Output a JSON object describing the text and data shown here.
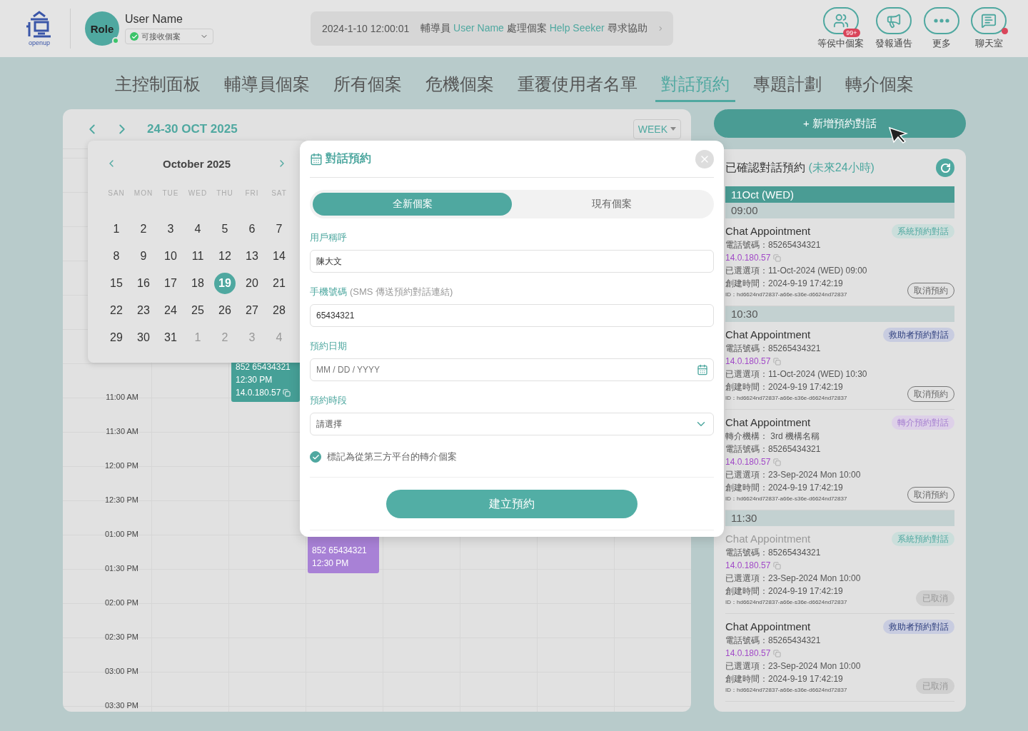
{
  "header": {
    "logo": "openup",
    "avatar": "Role",
    "online": true,
    "user_name": "User Name",
    "status": "可接收個案",
    "notice": {
      "time": "2024-1-10 12:00:01",
      "parts": [
        {
          "text": "輔導員 ",
          "highlight": false
        },
        {
          "text": "User Name",
          "highlight": true
        },
        {
          "text": " 處理個案 ",
          "highlight": false
        },
        {
          "text": "Help Seeker",
          "highlight": true
        },
        {
          "text": " 尋求協助",
          "highlight": false
        }
      ]
    },
    "actions": [
      {
        "kind": "waiting",
        "label": "等侯中個案",
        "badge": "99+",
        "alert": false
      },
      {
        "kind": "announce",
        "label": "發報通告",
        "alert": false
      },
      {
        "kind": "more",
        "label": "更多",
        "alert": false
      },
      {
        "kind": "chat",
        "label": "聊天室",
        "alert": true
      }
    ]
  },
  "tabs": [
    {
      "label": "主控制面板",
      "selected": false
    },
    {
      "label": "輔導員個案",
      "selected": false
    },
    {
      "label": "所有個案",
      "selected": false
    },
    {
      "label": "危機個案",
      "selected": false
    },
    {
      "label": "重覆使用者名單",
      "selected": false
    },
    {
      "label": "對話預約",
      "selected": true
    },
    {
      "label": "專題計劃",
      "selected": false
    },
    {
      "label": "轉介個案",
      "selected": false
    }
  ],
  "calendar": {
    "range": "24-30 OCT 2025",
    "view": "WEEK",
    "times": [
      "11:00 AM",
      "11:30 AM",
      "12:00 PM",
      "12:30 PM",
      "01:00 PM",
      "01:30 PM",
      "02:00 PM",
      "02:30 PM",
      "03:00 PM",
      "03:30 PM"
    ],
    "events": [
      {
        "color": "#46a097",
        "lines": [
          "852 65434321",
          "12:30 PM"
        ],
        "ip": "14.0.180.57"
      },
      {
        "color": "#a881d6",
        "lines": [
          "852 65434321",
          "12:30 PM"
        ]
      }
    ]
  },
  "date_picker": {
    "month": "October 2025",
    "weekdays": [
      "SAN",
      "MON",
      "TUE",
      "WED",
      "THU",
      "FRI",
      "SAT"
    ],
    "days": [
      {
        "label": "1",
        "outside": false,
        "selected": false
      },
      {
        "label": "2",
        "outside": false,
        "selected": false
      },
      {
        "label": "3",
        "outside": false,
        "selected": false
      },
      {
        "label": "4",
        "outside": false,
        "selected": false
      },
      {
        "label": "5",
        "outside": false,
        "selected": false
      },
      {
        "label": "6",
        "outside": false,
        "selected": false
      },
      {
        "label": "7",
        "outside": false,
        "selected": false
      },
      {
        "label": "8",
        "outside": false,
        "selected": false
      },
      {
        "label": "9",
        "outside": false,
        "selected": false
      },
      {
        "label": "10",
        "outside": false,
        "selected": false
      },
      {
        "label": "11",
        "outside": false,
        "selected": false
      },
      {
        "label": "12",
        "outside": false,
        "selected": false
      },
      {
        "label": "13",
        "outside": false,
        "selected": false
      },
      {
        "label": "14",
        "outside": false,
        "selected": false
      },
      {
        "label": "15",
        "outside": false,
        "selected": false
      },
      {
        "label": "16",
        "outside": false,
        "selected": false
      },
      {
        "label": "17",
        "outside": false,
        "selected": false
      },
      {
        "label": "18",
        "outside": false,
        "selected": false
      },
      {
        "label": "19",
        "outside": false,
        "selected": true
      },
      {
        "label": "20",
        "outside": false,
        "selected": false
      },
      {
        "label": "21",
        "outside": false,
        "selected": false
      },
      {
        "label": "22",
        "outside": false,
        "selected": false
      },
      {
        "label": "23",
        "outside": false,
        "selected": false
      },
      {
        "label": "24",
        "outside": false,
        "selected": false
      },
      {
        "label": "25",
        "outside": false,
        "selected": false
      },
      {
        "label": "26",
        "outside": false,
        "selected": false
      },
      {
        "label": "27",
        "outside": false,
        "selected": false
      },
      {
        "label": "28",
        "outside": false,
        "selected": false
      },
      {
        "label": "29",
        "outside": false,
        "selected": false
      },
      {
        "label": "30",
        "outside": false,
        "selected": false
      },
      {
        "label": "31",
        "outside": false,
        "selected": false
      },
      {
        "label": "1",
        "outside": true,
        "selected": false
      },
      {
        "label": "2",
        "outside": true,
        "selected": false
      },
      {
        "label": "3",
        "outside": true,
        "selected": false
      },
      {
        "label": "4",
        "outside": true,
        "selected": false
      }
    ]
  },
  "modal": {
    "title": "對話預約",
    "modes": [
      {
        "label": "全新個案",
        "selected": true
      },
      {
        "label": "現有個案",
        "selected": false
      }
    ],
    "fields": [
      {
        "kind": "text",
        "label": "用戶稱呼",
        "value": "陳大文"
      },
      {
        "kind": "text",
        "label": "手機號碼",
        "hint": "(SMS 傳送預約對話連結)",
        "value": "65434321"
      },
      {
        "kind": "date",
        "label": "預約日期",
        "placeholder": "MM / DD / YYYY"
      },
      {
        "kind": "select",
        "label": "預約時段",
        "value": "請選擇"
      }
    ],
    "referral": {
      "label": "標記為從第三方平台的轉介個案",
      "checked": true
    },
    "submit": "建立預約"
  },
  "add_button": "+ 新增預約對話",
  "appointments": {
    "title": "已確認對話預約",
    "subtitle": "(未來24小時)",
    "date": "11Oct (WED)",
    "slots": [
      {
        "time": "09:00",
        "items": [
          {
            "title": "Chat Appointment",
            "muted": false,
            "tag": {
              "kind": "system",
              "label": "系統預約對話"
            },
            "phone": "電話號碼：85265434321",
            "ip": "14.0.180.57",
            "chosen": "已選選項：11-Oct-2024 (WED) 09:00",
            "created": "創建時間：2024-9-19 17:42:19",
            "id": "ID：hd6624nd72837-a66e-s36e-d6624nd72837",
            "action": {
              "label": "取消預約",
              "cancelled": false
            }
          }
        ]
      },
      {
        "time": "10:30",
        "items": [
          {
            "title": "Chat Appointment",
            "muted": false,
            "tag": {
              "kind": "helper",
              "label": "救助者預約對話"
            },
            "phone": "電話號碼：85265434321",
            "ip": "14.0.180.57",
            "chosen": "已選選項：11-Oct-2024 (WED) 10:30",
            "created": "創建時間：2024-9-19 17:42:19",
            "id": "ID：hd6624nd72837-a66e-s36e-d6624nd72837",
            "action": {
              "label": "取消預約",
              "cancelled": false
            }
          },
          {
            "title": "Chat Appointment",
            "muted": false,
            "tag": {
              "kind": "referral",
              "label": "轉介預約對話"
            },
            "referrer": "轉介機構： 3rd 機構名稱",
            "phone": "電話號碼：85265434321",
            "ip": "14.0.180.57",
            "chosen": "已選選項：23-Sep-2024 Mon 10:00",
            "created": "創建時間：2024-9-19 17:42:19",
            "id": "ID：hd6624nd72837-a66e-s36e-d6624nd72837",
            "action": {
              "label": "取消預約",
              "cancelled": false
            }
          }
        ]
      },
      {
        "time": "11:30",
        "items": [
          {
            "title": "Chat Appointment",
            "muted": true,
            "tag": {
              "kind": "system",
              "label": "系統預約對話"
            },
            "phone": "電話號碼：85265434321",
            "ip": "14.0.180.57",
            "chosen": "已選選項：23-Sep-2024 Mon 10:00",
            "created": "創建時間：2024-9-19 17:42:19",
            "id": "ID：hd6624nd72837-a66e-s36e-d6624nd72837",
            "action": {
              "label": "已取消",
              "cancelled": true
            }
          },
          {
            "title": "Chat Appointment",
            "muted": false,
            "tag": {
              "kind": "helper",
              "label": "救助者預約對話"
            },
            "phone": "電話號碼：85265434321",
            "ip": "14.0.180.57",
            "chosen": "已選選項：23-Sep-2024 Mon 10:00",
            "created": "創建時間：2024-9-19 17:42:19",
            "id": "ID：hd6624nd72837-a66e-s36e-d6624nd72837",
            "action": {
              "label": "已取消",
              "cancelled": true
            }
          }
        ]
      }
    ]
  }
}
